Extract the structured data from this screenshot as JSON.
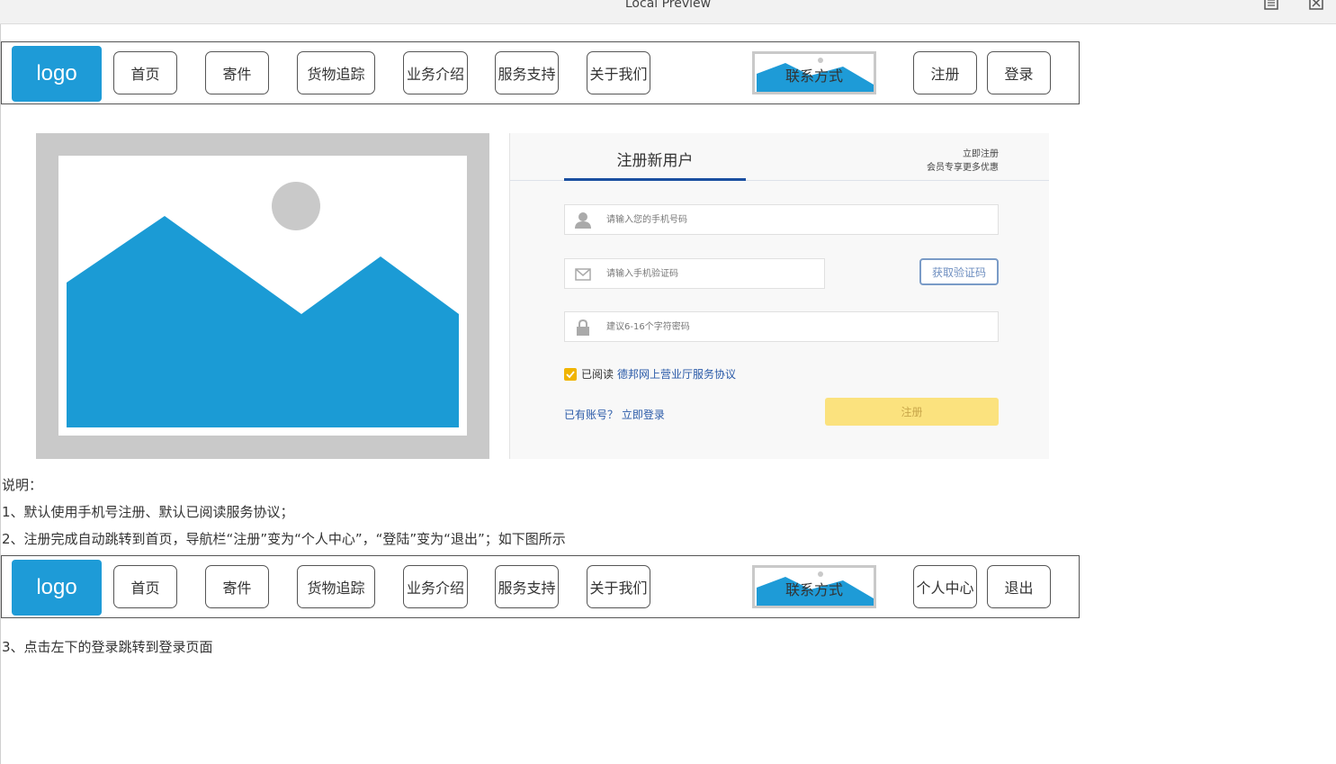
{
  "window": {
    "title": "Local Preview"
  },
  "nav_before": {
    "logo": "logo",
    "items": [
      "首页",
      "寄件",
      "货物追踪",
      "业务介绍",
      "服务支持",
      "关于我们"
    ],
    "contact": "联系方式",
    "right_buttons": [
      "注册",
      "登录"
    ]
  },
  "register_form": {
    "tab_title": "注册新用户",
    "promo_line1": "立即注册",
    "promo_line2": "会员专享更多优惠",
    "phone_placeholder": "请输入您的手机号码",
    "code_placeholder": "请输入手机验证码",
    "get_code": "获取验证码",
    "password_placeholder": "建议6-16个字符密码",
    "agree_prefix": "已阅读",
    "agree_link": "德邦网上营业厅服务协议",
    "login_link": "已有账号？ 立即登录",
    "submit": "注册"
  },
  "notes": {
    "title": "说明：",
    "line1": "1、默认使用手机号注册、默认已阅读服务协议；",
    "line2": "2、注册完成自动跳转到首页，导航栏“注册”变为“个人中心”，“登陆”变为“退出”；如下图所示",
    "line3": "3、点击左下的登录跳转到登录页面"
  },
  "nav_after": {
    "logo": "logo",
    "items": [
      "首页",
      "寄件",
      "货物追踪",
      "业务介绍",
      "服务支持",
      "关于我们"
    ],
    "contact": "联系方式",
    "right_buttons": [
      "个人中心",
      "退出"
    ]
  },
  "colors": {
    "accent_blue": "#1e9bd7",
    "link_blue": "#2a5aa8",
    "tab_underline": "#1b4fa0",
    "submit_yellow": "#fbe27e",
    "checkbox": "#f0b400"
  },
  "icons": [
    "document-icon",
    "close-icon",
    "user-icon",
    "mail-icon",
    "lock-icon",
    "check-icon",
    "image-placeholder-icon"
  ]
}
